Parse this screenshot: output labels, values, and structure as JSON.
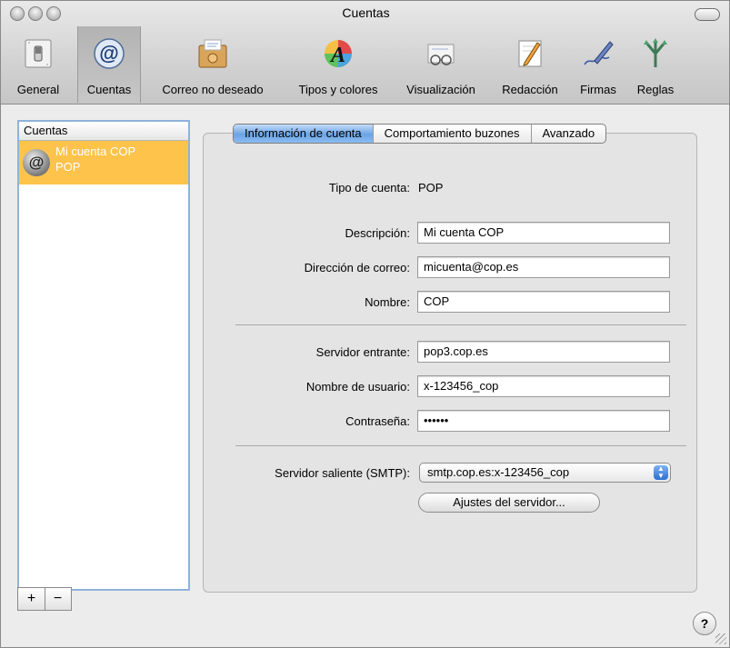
{
  "window": {
    "title": "Cuentas"
  },
  "toolbar": {
    "items": [
      {
        "label": "General",
        "icon": "switch-icon"
      },
      {
        "label": "Cuentas",
        "icon": "at-sign-icon"
      },
      {
        "label": "Correo no deseado",
        "icon": "junk-mail-icon"
      },
      {
        "label": "Tipos y colores",
        "icon": "fonts-colors-icon"
      },
      {
        "label": "Visualización",
        "icon": "viewing-glasses-icon"
      },
      {
        "label": "Redacción",
        "icon": "composing-pencil-icon"
      },
      {
        "label": "Firmas",
        "icon": "signature-pen-icon"
      },
      {
        "label": "Reglas",
        "icon": "rules-arrows-icon"
      }
    ]
  },
  "sidebar": {
    "header": "Cuentas",
    "accounts": [
      {
        "name": "Mi cuenta COP",
        "type": "POP"
      }
    ],
    "add_label": "+",
    "remove_label": "−"
  },
  "tabs": [
    {
      "label": "Información de cuenta",
      "active": true
    },
    {
      "label": "Comportamiento buzones",
      "active": false
    },
    {
      "label": "Avanzado",
      "active": false
    }
  ],
  "form": {
    "account_type_label": "Tipo de cuenta:",
    "account_type_value": "POP",
    "description_label": "Descripción:",
    "description_value": "Mi cuenta COP",
    "email_label": "Dirección de correo:",
    "email_value": "micuenta@cop.es",
    "name_label": "Nombre:",
    "name_value": "COP",
    "incoming_label": "Servidor entrante:",
    "incoming_value": "pop3.cop.es",
    "username_label": "Nombre de usuario:",
    "username_value": "x-123456_cop",
    "password_label": "Contraseña:",
    "password_value": "••••••",
    "smtp_label": "Servidor saliente (SMTP):",
    "smtp_value": "smtp.cop.es:x-123456_cop",
    "server_settings_button": "Ajustes del servidor..."
  },
  "help_label": "?",
  "colors": {
    "selected_row": "#fdc34b",
    "active_tab": "#6aa4e6",
    "list_focus_border": "#8fb2dc"
  }
}
